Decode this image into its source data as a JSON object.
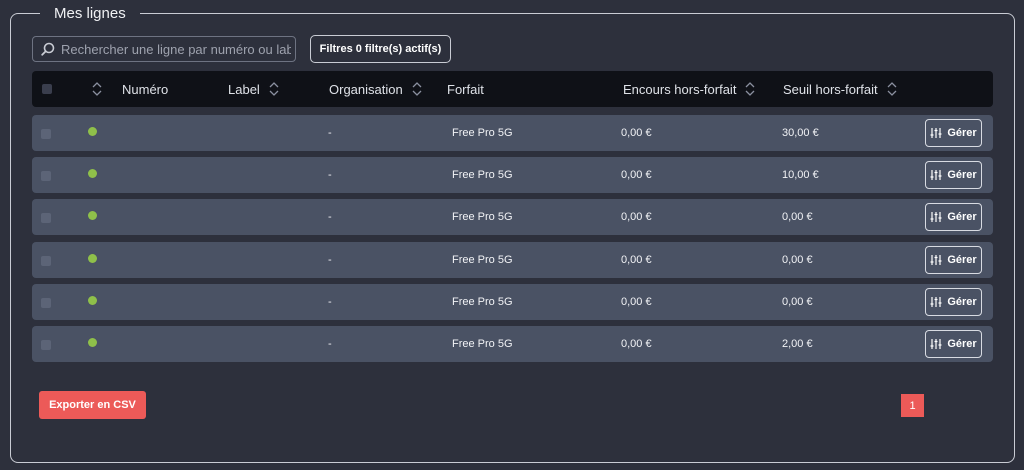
{
  "section": {
    "title": "Mes lignes"
  },
  "search": {
    "placeholder": "Rechercher une ligne par numéro ou label",
    "value": ""
  },
  "filters": {
    "label": "Filtres 0 filtre(s) actif(s)"
  },
  "table": {
    "columns": [
      "Numéro",
      "Label",
      "Organisation",
      "Forfait",
      "Encours hors-forfait",
      "Seuil hors-forfait"
    ],
    "rows": [
      {
        "status": "active",
        "numero": "",
        "label": "",
        "organisation": "-",
        "forfait": "Free Pro 5G",
        "encours": "0,00 €",
        "seuil": "30,00 €",
        "action": "Gérer"
      },
      {
        "status": "active",
        "numero": "",
        "label": "",
        "organisation": "-",
        "forfait": "Free Pro 5G",
        "encours": "0,00 €",
        "seuil": "10,00 €",
        "action": "Gérer"
      },
      {
        "status": "active",
        "numero": "",
        "label": "",
        "organisation": "-",
        "forfait": "Free Pro 5G",
        "encours": "0,00 €",
        "seuil": "0,00 €",
        "action": "Gérer"
      },
      {
        "status": "active",
        "numero": "",
        "label": "",
        "organisation": "-",
        "forfait": "Free Pro 5G",
        "encours": "0,00 €",
        "seuil": "0,00 €",
        "action": "Gérer"
      },
      {
        "status": "active",
        "numero": "",
        "label": "",
        "organisation": "-",
        "forfait": "Free Pro 5G",
        "encours": "0,00 €",
        "seuil": "0,00 €",
        "action": "Gérer"
      },
      {
        "status": "active",
        "numero": "",
        "label": "",
        "organisation": "-",
        "forfait": "Free Pro 5G",
        "encours": "0,00 €",
        "seuil": "2,00 €",
        "action": "Gérer"
      }
    ]
  },
  "export": {
    "label": "Exporter en CSV"
  },
  "pagination": {
    "current_page": "1"
  },
  "colors": {
    "accent": "#ec5a58",
    "status_active": "#8fc04a",
    "background": "#2d303c",
    "row": "#4a5264",
    "header": "#0f1117"
  },
  "icons": {
    "search": "search-icon",
    "sort": "sort-icon",
    "manage": "sliders-icon"
  }
}
